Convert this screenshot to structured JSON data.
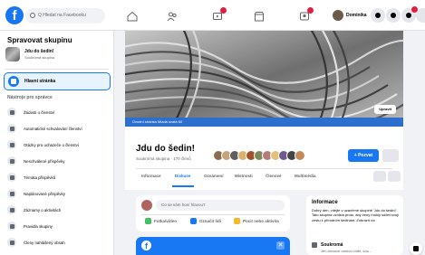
{
  "colors": {
    "accent": "#1877f2",
    "notification": "#e41e3f"
  },
  "topbar": {
    "logo": "f",
    "search_placeholder": "Q Hledat na Facebooku",
    "nav_icons": [
      "home-icon",
      "friends-icon",
      "watch-icon",
      "marketplace-icon",
      "groups-icon"
    ],
    "profile_name": "Dominika"
  },
  "sidebar": {
    "title": "Spravovat skupinu",
    "group_name": "Jdu do šedin!",
    "group_sub": "Soukromá skupina",
    "home_label": "Hlavní stránka",
    "tools_heading": "Nástroje pro správce",
    "items": [
      {
        "label": "Žádosti o členství",
        "icon": "member-requests-icon"
      },
      {
        "label": "Automatické schvalování členství",
        "icon": "auto-approve-icon"
      },
      {
        "label": "Otázky pro uchazeče o členství",
        "icon": "questions-icon"
      },
      {
        "label": "Neschválené příspěvky",
        "icon": "pending-posts-icon"
      },
      {
        "label": "Témata příspěvků",
        "icon": "topics-icon"
      },
      {
        "label": "Naplánované příspěvky",
        "icon": "scheduled-icon"
      },
      {
        "label": "Záznamy o aktivitách",
        "icon": "activity-log-icon"
      },
      {
        "label": "Pravidla skupiny",
        "icon": "rules-icon"
      },
      {
        "label": "Členy nahlášený obsah",
        "icon": "reported-icon"
      }
    ]
  },
  "cover": {
    "overlay_text": "Úvodní stránka Mladá svatá 60",
    "edit_label": "Upravit"
  },
  "group": {
    "title": "Jdu do šedin!",
    "meta": "Soukromá skupina · 170 členů",
    "invite_label": "+ Pozvat"
  },
  "tabs": [
    "Informace",
    "Diskuse",
    "Oznámení",
    "Místnosti",
    "Členové",
    "Multimédia"
  ],
  "composer": {
    "placeholder": "Co se vám honí hlavou?",
    "actions": [
      {
        "label": "Fotka/video",
        "icon": "photo-icon",
        "color": "#45bd62"
      },
      {
        "label": "Označit lidi",
        "icon": "tag-people-icon",
        "color": "#1877f2"
      },
      {
        "label": "Pocit nebo aktivita",
        "icon": "feeling-icon",
        "color": "#f7b928"
      }
    ]
  },
  "fb_card": {
    "logo": "f",
    "close": "✕"
  },
  "info": {
    "heading": "Informace",
    "body": "Dobrý den, vítejte v uzavřené skupině 'Jdu do šedin!'. Tato skupina vznikla proto, aby ženy mohly sdílet svoji cestu k přírodním šedinám. Zobrazit víc",
    "privacy_label": "Soukromá",
    "privacy_sub": "Jen členové mohou vidět, kdo..."
  }
}
